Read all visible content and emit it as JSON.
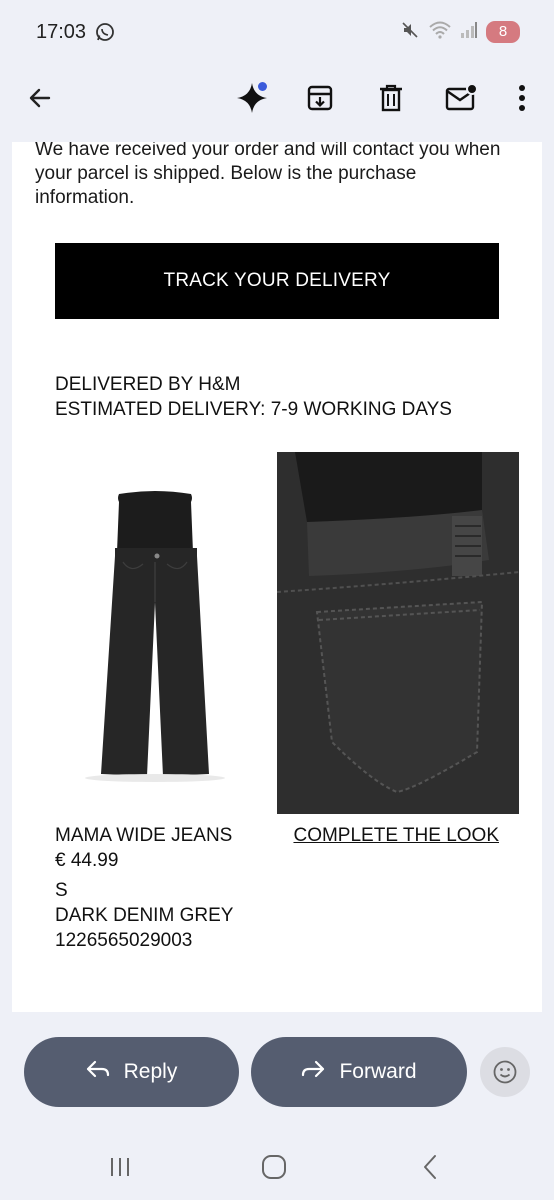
{
  "status_bar": {
    "time": "17:03",
    "battery_level": "8",
    "icons": [
      "whatsapp-icon",
      "mute-icon",
      "wifi-icon",
      "signal-icon",
      "battery-icon"
    ]
  },
  "app_bar": {
    "icons": [
      "back-arrow-icon",
      "gemini-sparkle-icon",
      "archive-icon",
      "delete-icon",
      "mark-unread-icon",
      "more-vert-icon"
    ]
  },
  "email": {
    "intro_text": "We have received your order and will contact you when your parcel is shipped. Below is the purchase information.",
    "track_button_label": "TRACK YOUR DELIVERY",
    "delivered_by": "DELIVERED BY H&M",
    "estimated_delivery": "ESTIMATED DELIVERY: 7-9 WORKING DAYS",
    "product": {
      "name": "MAMA WIDE JEANS",
      "price": "€ 44.99",
      "size": "S",
      "color": "DARK DENIM GREY",
      "article_number": "1226565029003"
    },
    "complete_the_look_label": "COMPLETE THE LOOK"
  },
  "actions": {
    "reply_label": "Reply",
    "forward_label": "Forward"
  },
  "colors": {
    "background": "#eef0f7",
    "action_button": "#555d70",
    "battery_badge": "#d57a80",
    "gemini_dot": "#3b5bdb"
  }
}
